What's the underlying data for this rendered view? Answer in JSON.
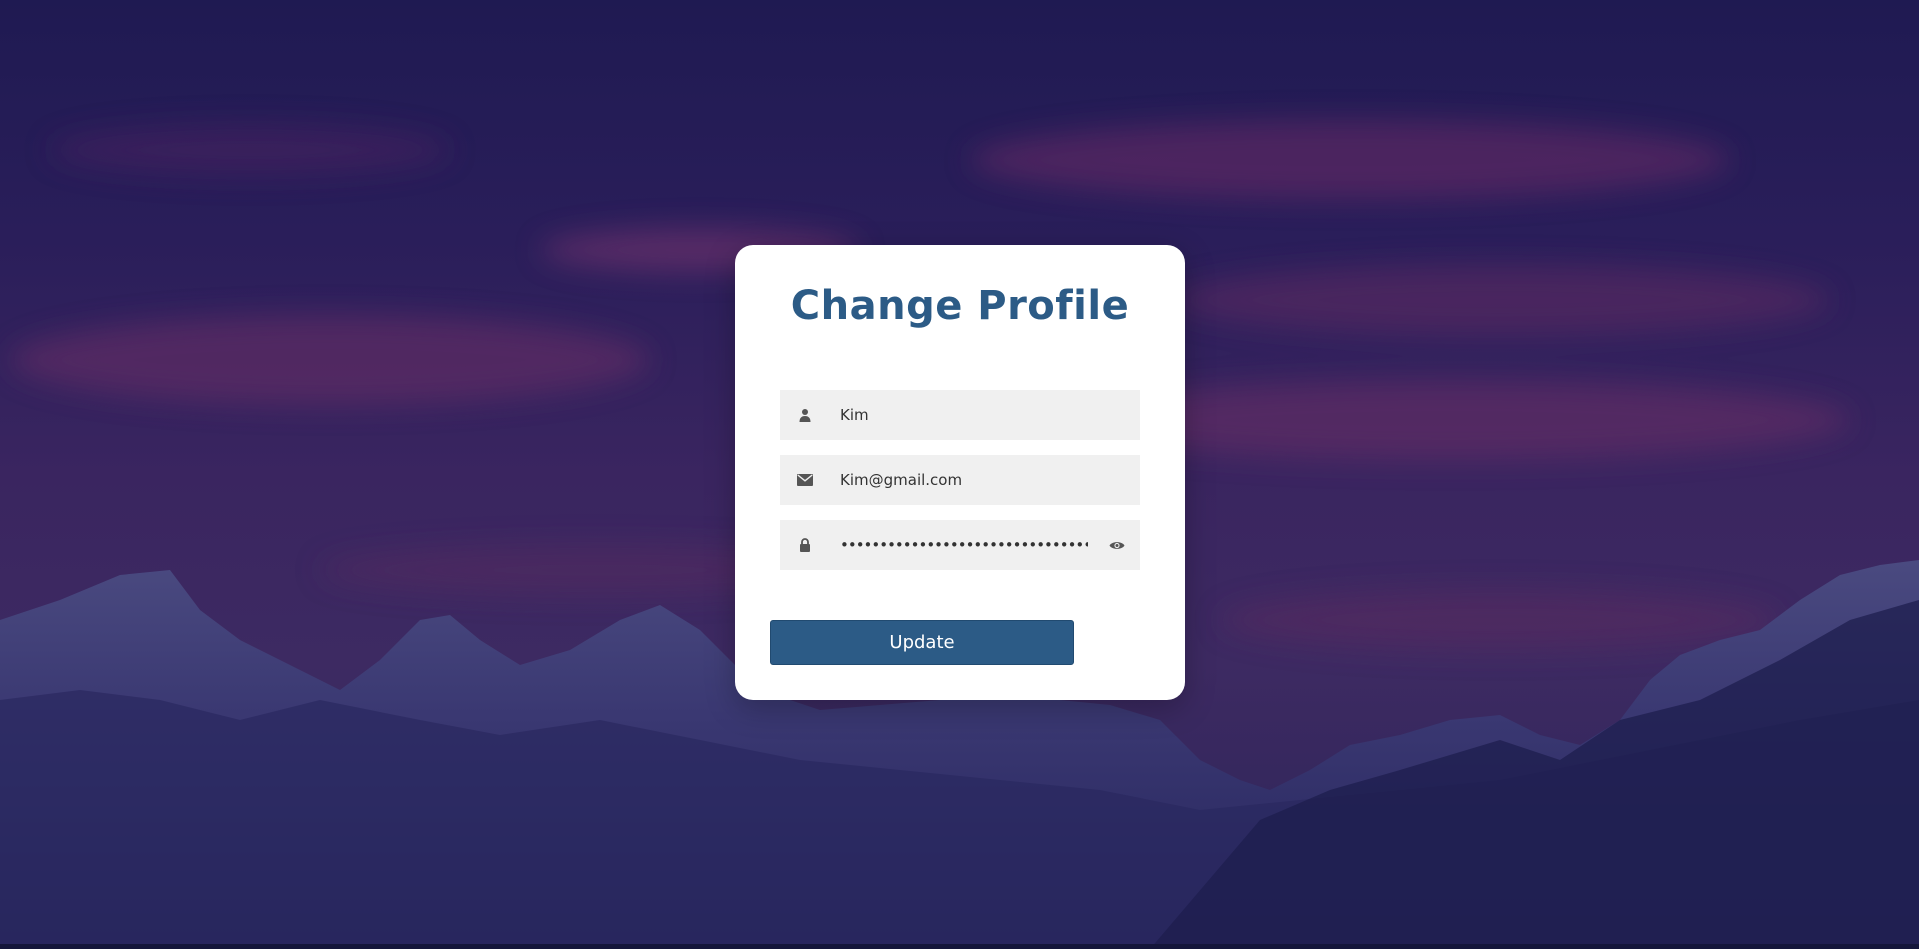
{
  "theme": {
    "accent": "#2c5b86",
    "card_bg": "#ffffff",
    "field_bg": "#f0f0f0",
    "icon_color": "#555555"
  },
  "form": {
    "title": "Change Profile",
    "name_value": "Kim",
    "email_value": "Kim@gmail.com",
    "password_value": "kim-secret-password-value-2024-abcdefghijklmno",
    "submit_label": "Update"
  },
  "icons": {
    "name": "user-icon",
    "email": "envelope-icon",
    "password": "lock-icon",
    "toggle": "eye-icon"
  }
}
